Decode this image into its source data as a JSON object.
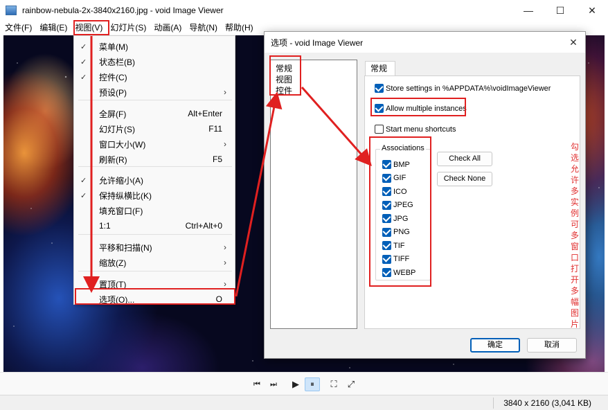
{
  "window": {
    "title": "rainbow-nebula-2x-3840x2160.jpg - void Image Viewer",
    "controls": {
      "minimize": "—",
      "maximize": "☐",
      "close": "✕"
    }
  },
  "menubar": [
    "文件(F)",
    "编辑(E)",
    "视图(V)",
    "幻灯片(S)",
    "动画(A)",
    "导航(N)",
    "帮助(H)"
  ],
  "view_menu": [
    {
      "label": "菜单(M)",
      "checked": true
    },
    {
      "label": "状态栏(B)",
      "checked": true
    },
    {
      "label": "控件(C)",
      "checked": true
    },
    {
      "label": "预设(P)",
      "submenu": true
    },
    {
      "separator": true
    },
    {
      "label": "全屏(F)",
      "shortcut": "Alt+Enter"
    },
    {
      "label": "幻灯片(S)",
      "shortcut": "F11"
    },
    {
      "label": "窗口大小(W)",
      "submenu": true
    },
    {
      "label": "刷新(R)",
      "shortcut": "F5"
    },
    {
      "separator": true
    },
    {
      "label": "允许缩小(A)",
      "checked": true
    },
    {
      "label": "保持纵横比(K)",
      "checked": true
    },
    {
      "label": "填充窗口(F)"
    },
    {
      "label": "1:1",
      "shortcut": "Ctrl+Alt+0"
    },
    {
      "separator": true
    },
    {
      "label": "平移和扫描(N)",
      "submenu": true
    },
    {
      "label": "缩放(Z)",
      "submenu": true
    },
    {
      "separator": true
    },
    {
      "label": "置顶(T)",
      "submenu": true
    },
    {
      "label": "选项(O)...",
      "shortcut": "O"
    }
  ],
  "dialog": {
    "title": "选项 - void Image Viewer",
    "close": "✕",
    "nav": [
      "常规",
      "视图",
      "控件"
    ],
    "tab": "常规",
    "store_settings": {
      "label": "Store settings in %APPDATA%\\voidImageViewer",
      "checked": true
    },
    "allow_multiple": {
      "label": "Allow multiple instances",
      "checked": true
    },
    "start_menu": {
      "label": "Start menu shortcuts",
      "checked": false
    },
    "associations": {
      "title": "Associations",
      "items": [
        "BMP",
        "GIF",
        "ICO",
        "JPEG",
        "JPG",
        "PNG",
        "TIF",
        "TIFF",
        "WEBP"
      ]
    },
    "check_all": "Check All",
    "check_none": "Check None",
    "ok": "确定",
    "cancel": "取消",
    "annotation": [
      "勾选允许多实例",
      "可多窗口打开多幅图片"
    ]
  },
  "toolbar_glyphs": {
    "prev": "⏮",
    "next": "⏭",
    "play": "▶",
    "pause": "⏸",
    "fit": "⛶",
    "fullscreen": "⤢"
  },
  "status": "3840 x 2160 (3,041 KB)",
  "colors": {
    "accent": "#005fb8",
    "annotation": "#e02020"
  }
}
